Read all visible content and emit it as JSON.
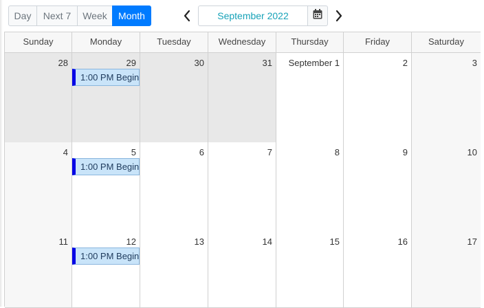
{
  "toolbar": {
    "views": [
      {
        "label": "Day",
        "active": false
      },
      {
        "label": "Next 7",
        "active": false
      },
      {
        "label": "Week",
        "active": false
      },
      {
        "label": "Month",
        "active": true
      }
    ],
    "current_period": "September 2022",
    "prev_icon": "chevron-left-icon",
    "next_icon": "chevron-right-icon",
    "calendar_icon": "calendar-icon"
  },
  "colors": {
    "accent": "#007bff",
    "date_text": "#17a2b8",
    "event_fill": "#c9e4f9",
    "event_bar": "#0000e6",
    "other_month": "#e8e8e8",
    "weekend": "#f7f7f7"
  },
  "weekdays": [
    "Sunday",
    "Monday",
    "Tuesday",
    "Wednesday",
    "Thursday",
    "Friday",
    "Saturday"
  ],
  "weeks": [
    {
      "days": [
        {
          "label": "28",
          "other": true
        },
        {
          "label": "29",
          "other": true,
          "event": "1:00 PM Begin"
        },
        {
          "label": "30",
          "other": true
        },
        {
          "label": "31",
          "other": true
        },
        {
          "label": "September 1"
        },
        {
          "label": "2"
        },
        {
          "label": "3",
          "weekend": true
        }
      ]
    },
    {
      "days": [
        {
          "label": "4",
          "weekend": true
        },
        {
          "label": "5",
          "event": "1:00 PM Begin"
        },
        {
          "label": "6"
        },
        {
          "label": "7"
        },
        {
          "label": "8"
        },
        {
          "label": "9"
        },
        {
          "label": "10",
          "weekend": true
        }
      ]
    },
    {
      "days": [
        {
          "label": "11",
          "weekend": true
        },
        {
          "label": "12",
          "event": "1:00 PM Begin"
        },
        {
          "label": "13"
        },
        {
          "label": "14"
        },
        {
          "label": "15"
        },
        {
          "label": "16"
        },
        {
          "label": "17",
          "weekend": true
        }
      ]
    }
  ]
}
